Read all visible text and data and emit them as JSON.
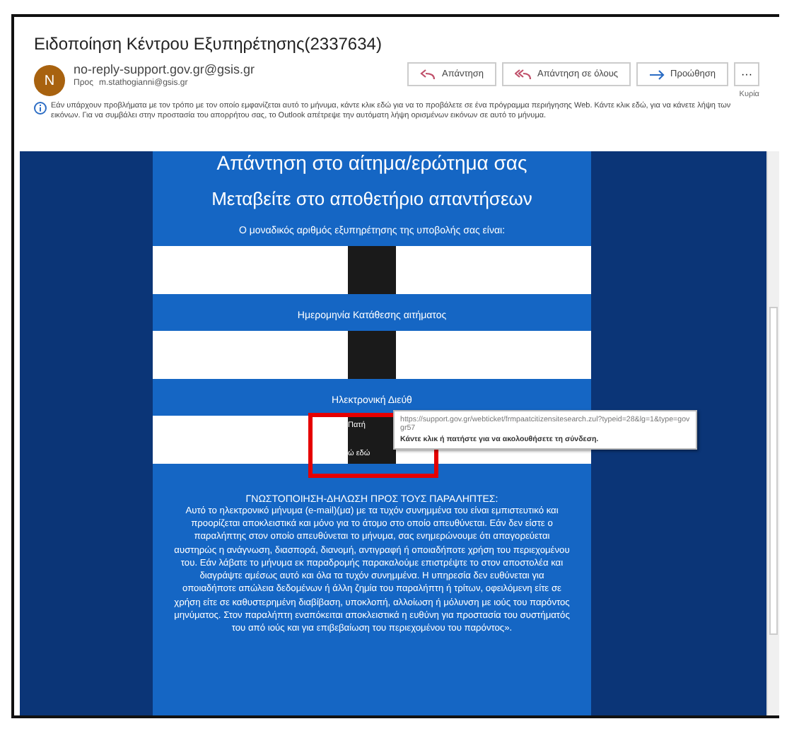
{
  "message": {
    "title": "Ειδοποίηση Κέντρου Εξυπηρέτησης(2337634)",
    "sender": {
      "initial": "N",
      "email": "no-reply-support.gov.gr@gsis.gr",
      "to_label": "Προς",
      "recipient": "m.stathogianni@gsis.gr"
    },
    "actions": [
      {
        "label": "Απάντηση",
        "kind": "reply"
      },
      {
        "label": "Απάντηση σε όλους",
        "kind": "reply-all"
      },
      {
        "label": "Προώθηση",
        "kind": "forward"
      }
    ],
    "more": "···",
    "date": "Κυρία",
    "info": "Εάν υπάρχουν προβλήματα με τον τρόπο με τον οποίο εμφανίζεται αυτό το μήνυμα, κάντε κλικ εδώ για να το προβάλετε σε ένα πρόγραμμα περιήγησης Web. Κάντε κλικ εδώ, για να κάνετε λήψη των εικόνων. Για να συμβάλει στην προστασία του απορρήτου σας, το Outlook απέτρεψε την αυτόματη λήψη ορισμένων εικόνων σε αυτό το μήνυμα."
  },
  "body": {
    "heading": "Απάντηση στο αίτημα/ερώτημα σας",
    "subheading": "Μεταβείτε στο αποθετήριο απαντήσεων",
    "sections": [
      {
        "label": "Ο μοναδικός αριθμός εξυπηρέτησης της υποβολής σας είναι:"
      },
      {
        "label": "Ημερομηνία Κατάθεσης αιτήματος"
      },
      {
        "label": "Ηλεκτρονική Διεύθ",
        "redacted_text": [
          "Πατή",
          "ώ εδώ"
        ]
      }
    ],
    "notice_title": "ΓΝΩΣΤΟΠΟΙΗΣΗ-ΔΗΛΩΣΗ ΠΡΟΣ ΤΟΥΣ ΠΑΡΑΛΗΠΤΕΣ:",
    "notice_text": "Αυτό το ηλεκτρονικό μήνυμα (e-mail)(μα) με τα τυχόν συνημμένα του είναι εμπιστευτικό και προορίζεται αποκλειστικά και μόνο για το άτομο στο οποίο απευθύνεται. Εάν δεν είστε ο παραλήπτης στον οποίο απευθύνεται το μήνυμα, σας ενημερώνουμε ότι απαγορεύεται αυστηρώς η ανάγνωση, διασπορά, διανομή, αντιγραφή ή οποιαδήποτε χρήση του περιεχομένου του. Εάν λάβατε το μήνυμα εκ παραδρομής παρακαλούμε επιστρέψτε το στον αποστολέα και διαγράψτε αμέσως αυτό και όλα τα τυχόν συνημμένα. Η υπηρεσία δεν ευθύνεται για οποιαδήποτε απώλεια δεδομένων ή άλλη ζημία του παραλήπτη ή τρίτων, οφειλόμενη είτε σε χρήση είτε σε καθυστερημένη διαβίβαση, υποκλοπή, αλλοίωση ή μόλυνση με ιούς του παρόντος μηνύματος. Στον παραλήπτη εναπόκειται αποκλειστικά η ευθύνη για προστασία του συστήματός του από ιούς και για επιβεβαίωση του περιεχομένου του παρόντος»."
  },
  "tooltip": {
    "url": "https://support.gov.gr/webticket/frmpaatcitizensitesearch.zul?typeid=28&lg=1&type=govgr57",
    "hint": "Κάντε κλικ ή πατήστε για να ακολουθήσετε τη σύνδεση."
  }
}
